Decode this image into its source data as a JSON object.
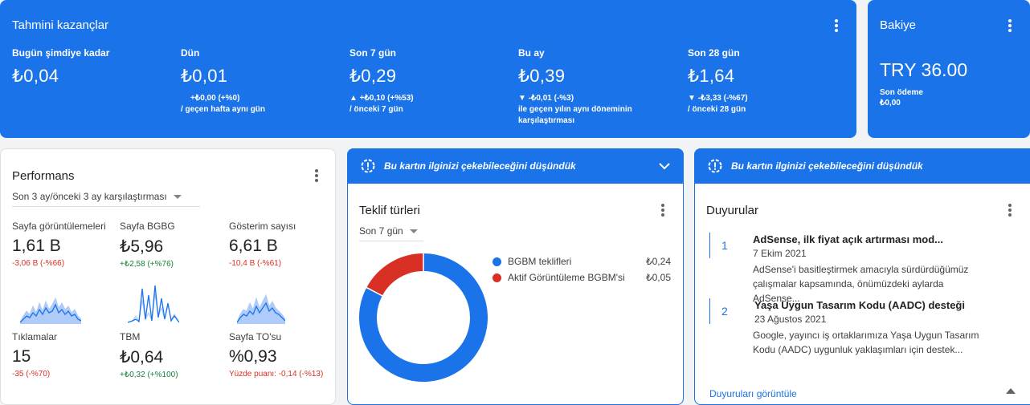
{
  "earnings": {
    "title": "Tahmini kazançlar",
    "metrics": [
      {
        "label": "Bugün şimdiye kadar",
        "value": "₺0,04",
        "line1": "",
        "line2": "",
        "line3": ""
      },
      {
        "label": "Dün",
        "value": "₺0,01",
        "line1": "+₺0,00 (+%0)",
        "line2": "/ geçen hafta aynı gün",
        "line3": ""
      },
      {
        "label": "Son 7 gün",
        "value": "₺0,29",
        "line1": "▲ +₺0,10 (+%53)",
        "line2": "/ önceki 7 gün",
        "line3": ""
      },
      {
        "label": "Bu ay",
        "value": "₺0,39",
        "line1": "▼ -₺0,01 (-%3)",
        "line2": "ile geçen yılın aynı döneminin",
        "line3": "karşılaştırması"
      },
      {
        "label": "Son 28 gün",
        "value": "₺1,64",
        "line1": "▼ -₺3,33 (-%67)",
        "line2": "/ önceki 28 gün",
        "line3": ""
      }
    ]
  },
  "balance": {
    "title": "Bakiye",
    "value": "TRY 36.00",
    "last_payment_label": "Son ödeme",
    "last_payment_value": "₺0,00"
  },
  "performance": {
    "title": "Performans",
    "period": "Son 3 ay/önceki 3 ay karşılaştırması",
    "metrics": [
      {
        "label": "Sayfa görüntülemeleri",
        "value": "1,61 B",
        "change": "-3,06 B (-%66)",
        "trend": "neg"
      },
      {
        "label": "Sayfa BGBG",
        "value": "₺5,96",
        "change": "+₺2,58 (+%76)",
        "trend": "pos"
      },
      {
        "label": "Gösterim sayısı",
        "value": "6,61 B",
        "change": "-10,4 B (-%61)",
        "trend": "neg"
      },
      {
        "label": "Tıklamalar",
        "value": "15",
        "change": "-35 (-%70)",
        "trend": "neg"
      },
      {
        "label": "TBM",
        "value": "₺0,64",
        "change": "+₺0,32 (+%100)",
        "trend": "pos"
      },
      {
        "label": "Sayfa TO'su",
        "value": "%0,93",
        "change": "Yüzde puanı: -0,14 (-%13)",
        "trend": "neg"
      }
    ]
  },
  "suggestion_banner": {
    "text": "Bu kartın ilginizi çekebileceğini düşündük"
  },
  "bid_types": {
    "title": "Teklif türleri",
    "period": "Son 7 gün",
    "colors": {
      "primary": "#1a73e8",
      "secondary": "#d93025"
    },
    "legend": [
      {
        "name": "BGBM teklifleri",
        "value": "₺0,24",
        "color": "#1a73e8"
      },
      {
        "name": "Aktif Görüntüleme BGBM'si",
        "value": "₺0,05",
        "color": "#d93025"
      }
    ],
    "chart_data": {
      "type": "pie",
      "labels": [
        "BGBM teklifleri",
        "Aktif Görüntüleme BGBM'si"
      ],
      "values": [
        0.24,
        0.05
      ]
    }
  },
  "announcements": {
    "title": "Duyurular",
    "items": [
      {
        "num": "1",
        "title": "AdSense, ilk fiyat açık artırması mod...",
        "date": "7 Ekim 2021",
        "body": "AdSense'i basitleştirmek amacıyla sürdürdüğümüz çalışmalar kapsamında, önümüzdeki aylarda AdSense..."
      },
      {
        "num": "2",
        "title": "Yaşa Uygun Tasarım Kodu (AADC) desteği",
        "date": "23 Ağustos 2021",
        "body": "Google, yayıncı iş ortaklarımıza Yaşa Uygun Tasarım Kodu (AADC) uygunluk yaklaşımları için destek..."
      }
    ],
    "view_all": "Duyuruları görüntüle"
  }
}
